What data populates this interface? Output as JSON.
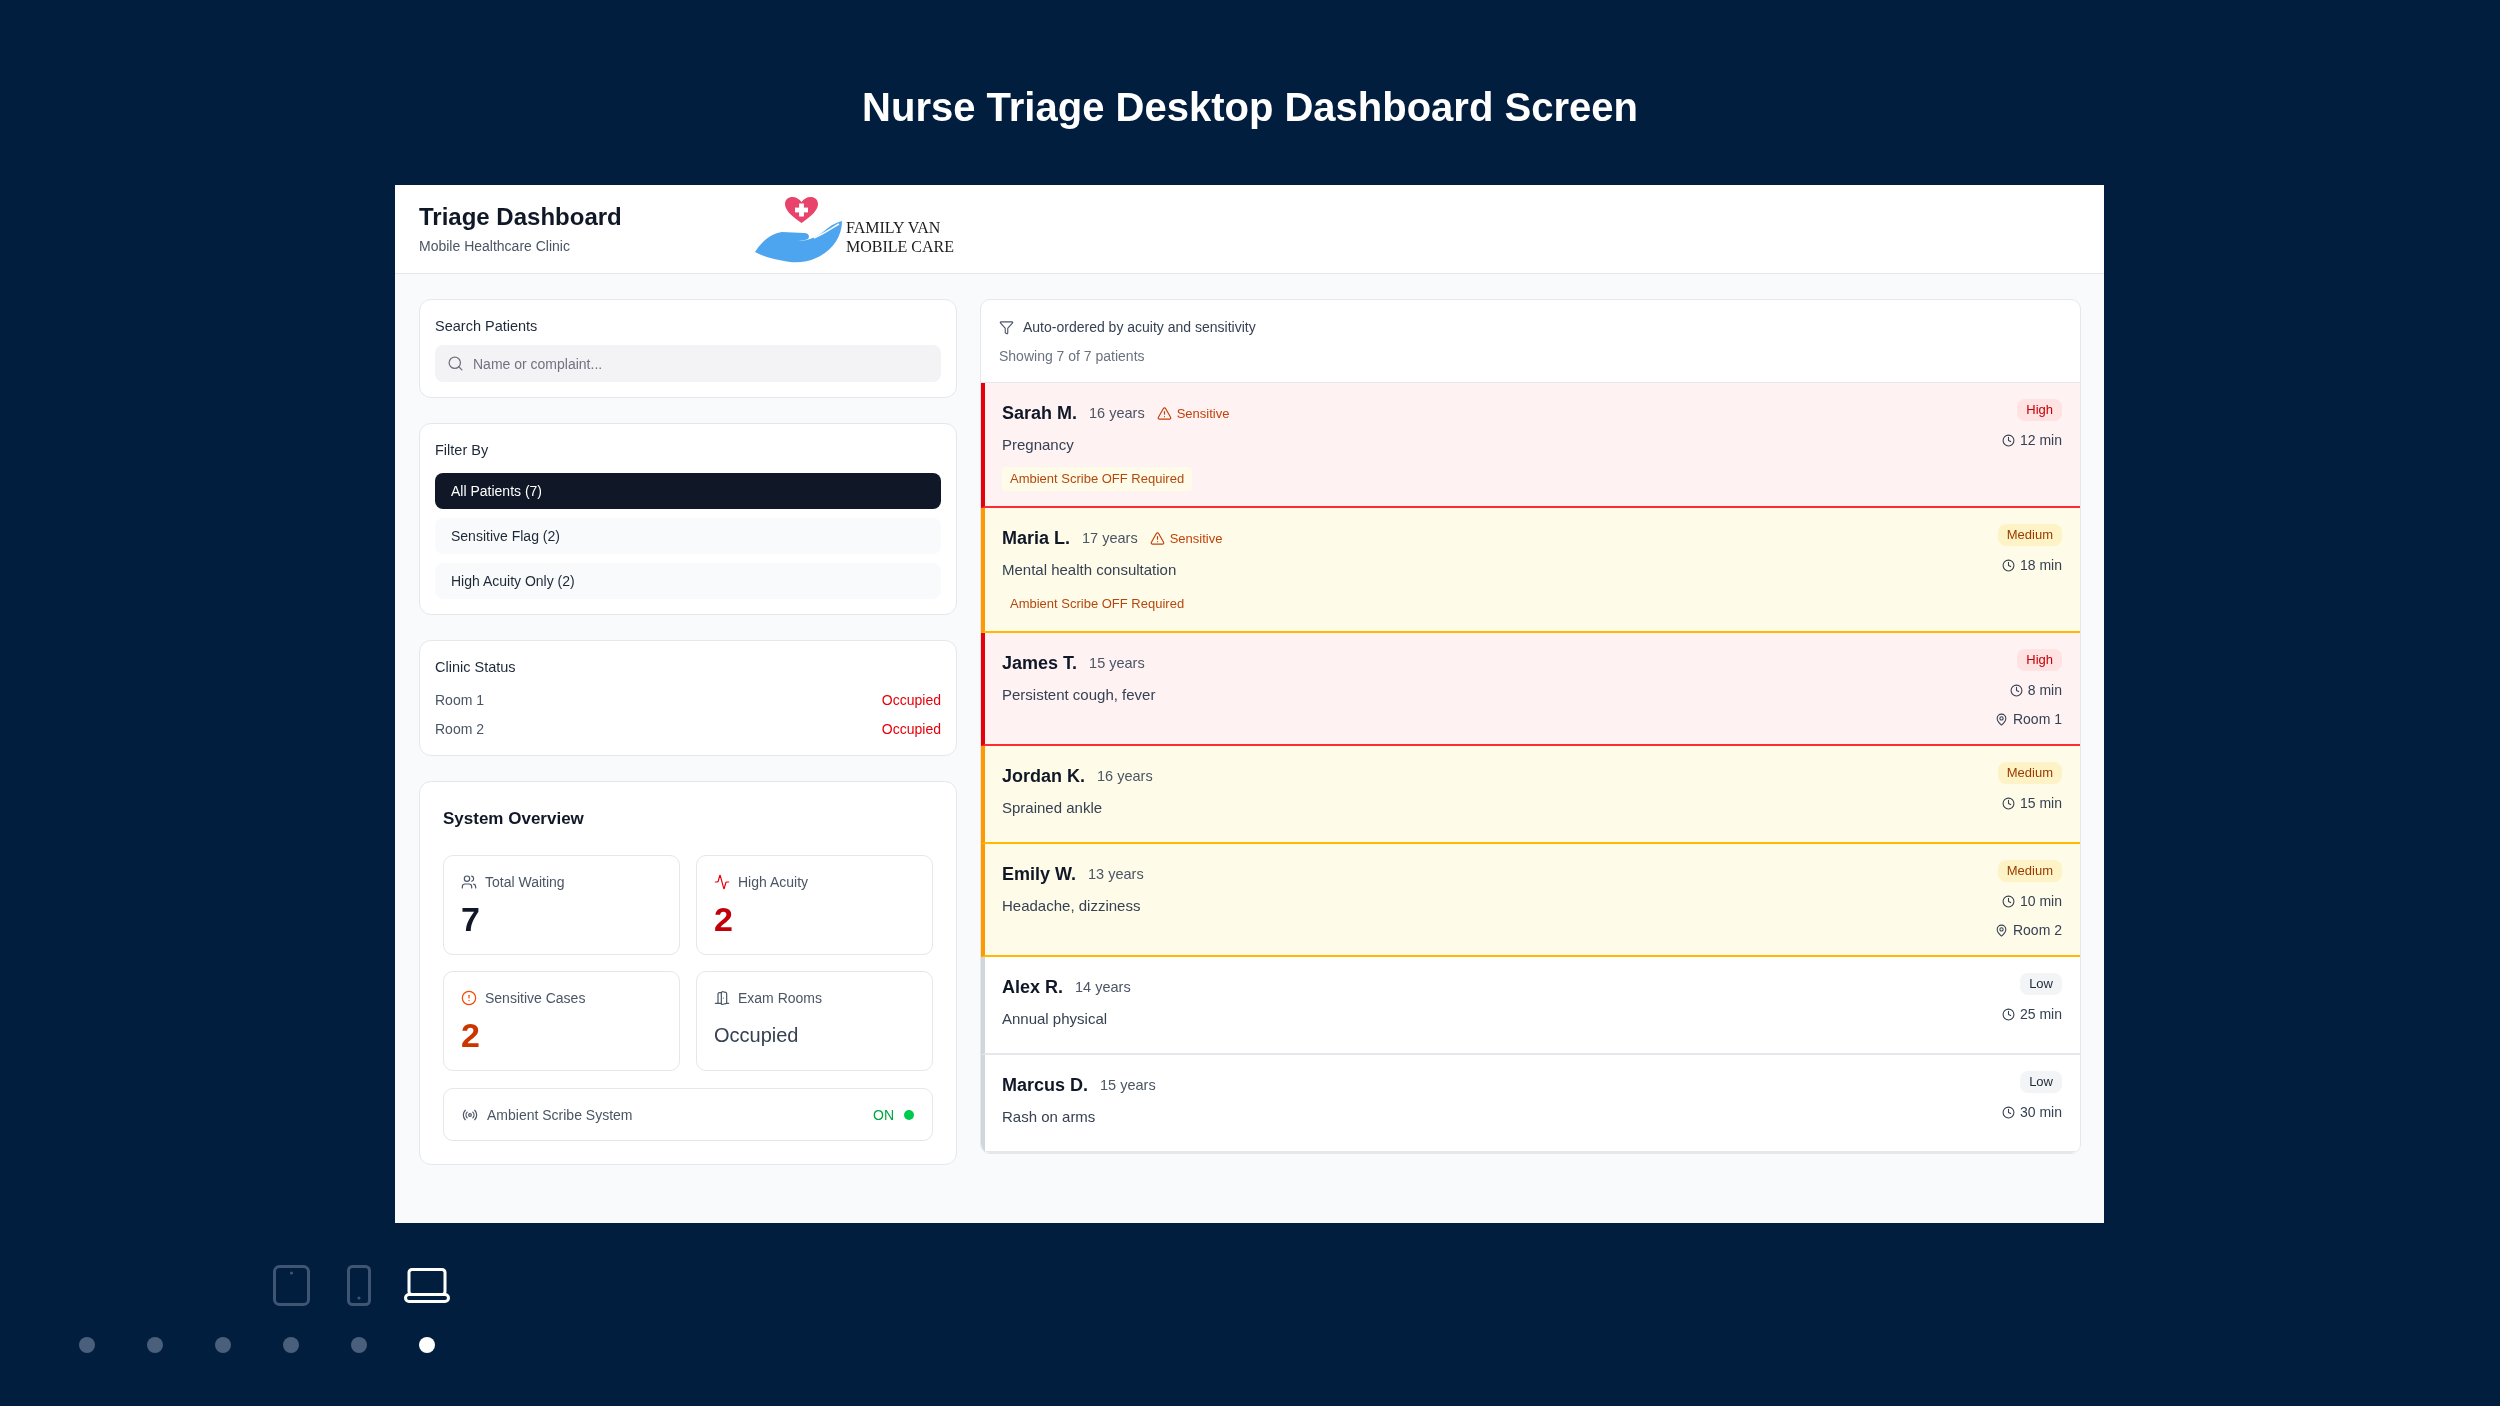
{
  "page_title": "Nurse Triage Desktop Dashboard Screen",
  "header": {
    "title": "Triage Dashboard",
    "subtitle": "Mobile Healthcare Clinic",
    "logo_lines": [
      "FAMILY VAN",
      "MOBILE CARE"
    ]
  },
  "search": {
    "label": "Search Patients",
    "placeholder": "Name or complaint..."
  },
  "filter": {
    "label": "Filter By",
    "options": [
      {
        "label": "All Patients (7)",
        "selected": true
      },
      {
        "label": "Sensitive Flag (2)",
        "selected": false
      },
      {
        "label": "High Acuity Only (2)",
        "selected": false
      }
    ]
  },
  "clinic_status": {
    "title": "Clinic Status",
    "rooms": [
      {
        "name": "Room 1",
        "status": "Occupied",
        "kind": "occupied"
      },
      {
        "name": "Room 2",
        "status": "Occupied",
        "kind": "occupied"
      }
    ]
  },
  "overview": {
    "title": "System Overview",
    "stats": [
      {
        "kind": "waiting",
        "label": "Total Waiting",
        "value": "7"
      },
      {
        "kind": "acuity",
        "label": "High Acuity",
        "value": "2"
      },
      {
        "kind": "sensitive",
        "label": "Sensitive Cases",
        "value": "2"
      },
      {
        "kind": "rooms",
        "label": "Exam Rooms",
        "value": "Occupied"
      }
    ],
    "scribe": {
      "label": "Ambient Scribe System",
      "status": "ON",
      "on": true
    }
  },
  "patient_list": {
    "sort_note": "Auto-ordered by acuity and sensitivity",
    "count": "Showing 7 of 7 patients",
    "patients": [
      {
        "kind": "high",
        "name": "Sarah M.",
        "age": "16 years",
        "sensitive": true,
        "flag": "Sensitive",
        "complaint": "Pregnancy",
        "note": "Ambient Scribe OFF Required",
        "acuity": "High",
        "wait": "12 min"
      },
      {
        "kind": "medium",
        "name": "Maria L.",
        "age": "17 years",
        "sensitive": true,
        "flag": "Sensitive",
        "complaint": "Mental health consultation",
        "note": "Ambient Scribe OFF Required",
        "acuity": "Medium",
        "wait": "18 min"
      },
      {
        "kind": "high",
        "name": "James T.",
        "age": "15 years",
        "sensitive": false,
        "complaint": "Persistent cough, fever",
        "acuity": "High",
        "wait": "8 min",
        "room": "Room 1"
      },
      {
        "kind": "medium",
        "name": "Jordan K.",
        "age": "16 years",
        "sensitive": false,
        "complaint": "Sprained ankle",
        "acuity": "Medium",
        "wait": "15 min"
      },
      {
        "kind": "medium",
        "name": "Emily W.",
        "age": "13 years",
        "sensitive": false,
        "complaint": "Headache, dizziness",
        "acuity": "Medium",
        "wait": "10 min",
        "room": "Room 2"
      },
      {
        "kind": "low",
        "name": "Alex R.",
        "age": "14 years",
        "sensitive": false,
        "complaint": "Annual physical",
        "acuity": "Low",
        "wait": "25 min"
      },
      {
        "kind": "low",
        "name": "Marcus D.",
        "age": "15 years",
        "sensitive": false,
        "complaint": "Rash on arms",
        "acuity": "Low",
        "wait": "30 min"
      }
    ]
  },
  "device_switcher": [
    {
      "kind": "tablet",
      "selected": false
    },
    {
      "kind": "phone",
      "selected": false
    },
    {
      "kind": "laptop",
      "selected": true
    }
  ],
  "pager": [
    {
      "selected": false
    },
    {
      "selected": false
    },
    {
      "selected": false
    },
    {
      "selected": false
    },
    {
      "selected": false
    },
    {
      "selected": true
    }
  ]
}
